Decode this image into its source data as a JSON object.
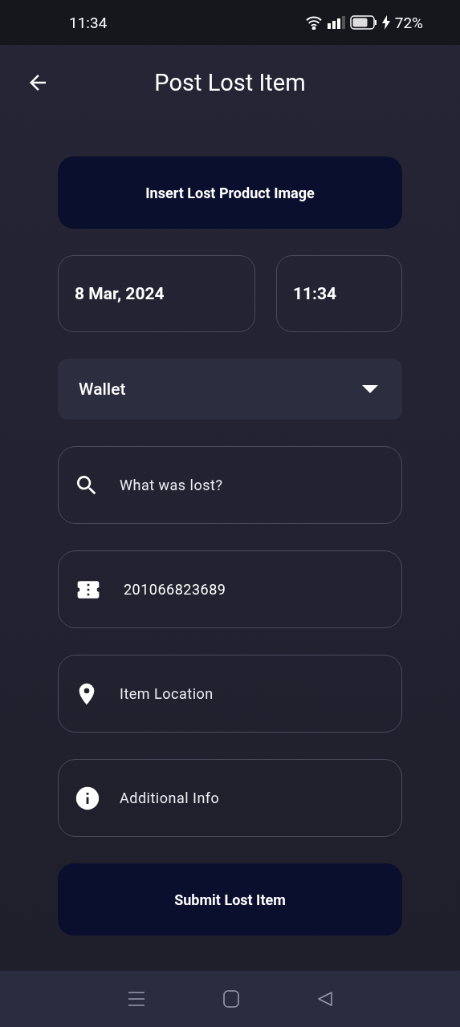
{
  "status_bar": {
    "time": "11:34",
    "battery": "72%"
  },
  "header": {
    "title": "Post Lost Item"
  },
  "image_button": {
    "label": "Insert Lost Product Image"
  },
  "date": {
    "value": "8 Mar, 2024"
  },
  "time": {
    "value": "11:34"
  },
  "category": {
    "value": "Wallet"
  },
  "fields": [
    {
      "kind": "search",
      "placeholder": "What was lost?"
    },
    {
      "kind": "ticket",
      "value": "201066823689"
    },
    {
      "kind": "location",
      "placeholder": "Item Location"
    },
    {
      "kind": "info",
      "placeholder": "Additional Info"
    }
  ],
  "submit_button": {
    "label": "Submit Lost Item"
  }
}
